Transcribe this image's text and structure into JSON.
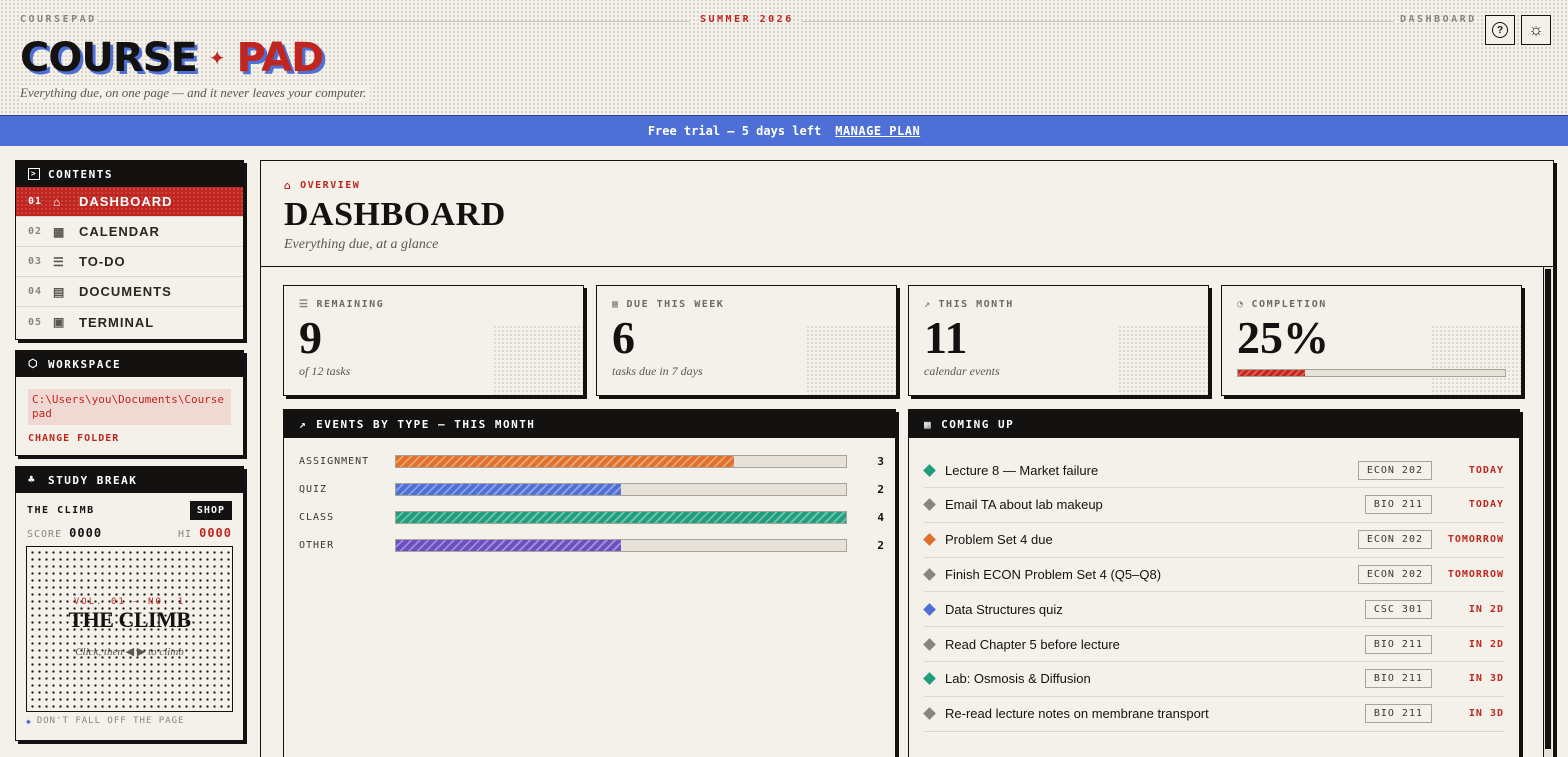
{
  "header": {
    "brand_small": "COURSEPAD",
    "season": "SUMMER 2026",
    "section": "DASHBOARD",
    "logo_word1": "COURSE",
    "logo_sep": "✦",
    "logo_word2": "PAD",
    "tagline": "Everything due, on one page — and it never leaves your computer.",
    "help_icon": "?",
    "theme_icon": "☼"
  },
  "banner": {
    "text": "Free trial — 5 days left",
    "link": "MANAGE PLAN"
  },
  "sidebar": {
    "contents_title": "CONTENTS",
    "items": [
      {
        "num": "01",
        "icon": "⌂",
        "label": "DASHBOARD"
      },
      {
        "num": "02",
        "icon": "▦",
        "label": "CALENDAR"
      },
      {
        "num": "03",
        "icon": "☰",
        "label": "TO-DO"
      },
      {
        "num": "04",
        "icon": "▤",
        "label": "DOCUMENTS"
      },
      {
        "num": "05",
        "icon": "▣",
        "label": "TERMINAL"
      }
    ],
    "workspace_title": "WORKSPACE",
    "workspace_path": "C:\\Users\\you\\Documents\\Course pad",
    "change_folder": "CHANGE FOLDER",
    "study_title": "STUDY BREAK",
    "game_title": "THE CLIMB",
    "shop_label": "SHOP",
    "score_label": "SCORE",
    "score_value": "0000",
    "hi_label": "HI",
    "hi_value": "0000",
    "game_vol": "VOL. 01 — NO. 1",
    "game_name": "THE CLIMB",
    "game_hint": "Click, then ◀ ▶ to climb",
    "game_foot": "DON'T FALL OFF THE PAGE"
  },
  "main": {
    "overview": "OVERVIEW",
    "title": "DASHBOARD",
    "subtitle": "Everything due, at a glance",
    "stats": [
      {
        "icon": "☰",
        "label": "REMAINING",
        "value": "9",
        "sub": "of 12 tasks"
      },
      {
        "icon": "▦",
        "label": "DUE THIS WEEK",
        "value": "6",
        "sub": "tasks due in 7 days"
      },
      {
        "icon": "↗",
        "label": "THIS MONTH",
        "value": "11",
        "sub": "calendar events"
      },
      {
        "icon": "◔",
        "label": "COMPLETION",
        "value": "25%",
        "progress": 0.25
      }
    ],
    "events_title": "EVENTS BY TYPE — THIS MONTH",
    "coming_title": "COMING UP"
  },
  "chart_data": {
    "type": "bar",
    "categories": [
      "ASSIGNMENT",
      "QUIZ",
      "CLASS",
      "OTHER"
    ],
    "values": [
      3,
      2,
      4,
      2
    ],
    "colors": [
      "#e0702a",
      "#4d6fd6",
      "#1f9e7e",
      "#6b4fc2"
    ],
    "title": "EVENTS BY TYPE — THIS MONTH",
    "xlim": [
      0,
      4
    ]
  },
  "upcoming": [
    {
      "color": "#1f9e7e",
      "title": "Lecture 8 — Market failure",
      "course": "ECON 202",
      "when": "TODAY"
    },
    {
      "color": "#8a857c",
      "title": "Email TA about lab makeup",
      "course": "BIO 211",
      "when": "TODAY"
    },
    {
      "color": "#e0702a",
      "title": "Problem Set 4 due",
      "course": "ECON 202",
      "when": "TOMORROW"
    },
    {
      "color": "#8a857c",
      "title": "Finish ECON Problem Set 4 (Q5–Q8)",
      "course": "ECON 202",
      "when": "TOMORROW"
    },
    {
      "color": "#4d6fd6",
      "title": "Data Structures quiz",
      "course": "CSC 301",
      "when": "IN 2D"
    },
    {
      "color": "#8a857c",
      "title": "Read Chapter 5 before lecture",
      "course": "BIO 211",
      "when": "IN 2D"
    },
    {
      "color": "#1f9e7e",
      "title": "Lab: Osmosis & Diffusion",
      "course": "BIO 211",
      "when": "IN 3D"
    },
    {
      "color": "#8a857c",
      "title": "Re-read lecture notes on membrane transport",
      "course": "BIO 211",
      "when": "IN 3D"
    }
  ]
}
